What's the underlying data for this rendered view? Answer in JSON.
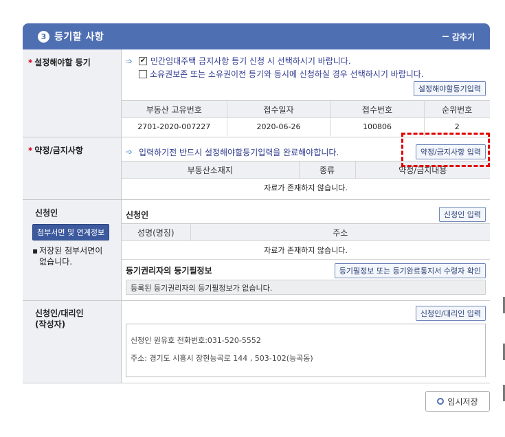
{
  "header": {
    "step": "3",
    "title": "등기할 사항",
    "collapse_label": "감추기"
  },
  "section1": {
    "label": "설정해야할 등기",
    "options": [
      {
        "text": "민간임대주택 금지사항 등기 신청 시 선택하시기 바랍니다.",
        "checked": true
      },
      {
        "text": "소유권보존 또는 소유권이전 등기와 동시에 신청하실 경우 선택하시기 바랍니다.",
        "checked": false
      }
    ],
    "button": "설정해야할등기입력",
    "table": {
      "headers": [
        "부동산 고유번호",
        "접수일자",
        "접수번호",
        "순위번호"
      ],
      "rows": [
        [
          "2701-2020-007227",
          "2020-06-26",
          "100806",
          "2"
        ]
      ]
    }
  },
  "section2": {
    "label": "약정/금지사항",
    "hint": "입력하기전 반드시 설정해야할등기입력을 완료해야합니다.",
    "button": "약정/금지사항 입력",
    "table": {
      "headers": [
        "부동산소재지",
        "종류",
        "약정/금지내용"
      ],
      "empty": "자료가 존재하지 않습니다."
    }
  },
  "section3": {
    "label": "신청인",
    "attach_button": "첨부서면 및 연계정보",
    "note": "저장된 첨부서면이 없습니다.",
    "heading": "신청인",
    "button": "신청인 입력",
    "table": {
      "headers": [
        "성명(명칭)",
        "주소"
      ],
      "empty": "자료가 존재하지 않습니다."
    },
    "sub_heading": "등기권리자의 등기필정보",
    "sub_button": "등기필정보 또는 등기완료통지서 수령자 확인",
    "sub_info": "등록된 등기권리자의 등기필정보가 없습니다."
  },
  "section4": {
    "label_line1": "신청인/대리인",
    "label_line2": "(작성자)",
    "button": "신청인/대리인 입력",
    "text_line1": "신청인 원유호 전화번호:031-520-5552",
    "text_line2": "주소: 경기도 시흥시 장현능곡로 144 , 503-102(능곡동)"
  },
  "footer": {
    "save_label": "임시저장"
  },
  "colors": {
    "header_bg": "#4f6fb3",
    "label_bg": "#eef0f4",
    "required": "#d0021b",
    "highlight": "#e00000"
  }
}
